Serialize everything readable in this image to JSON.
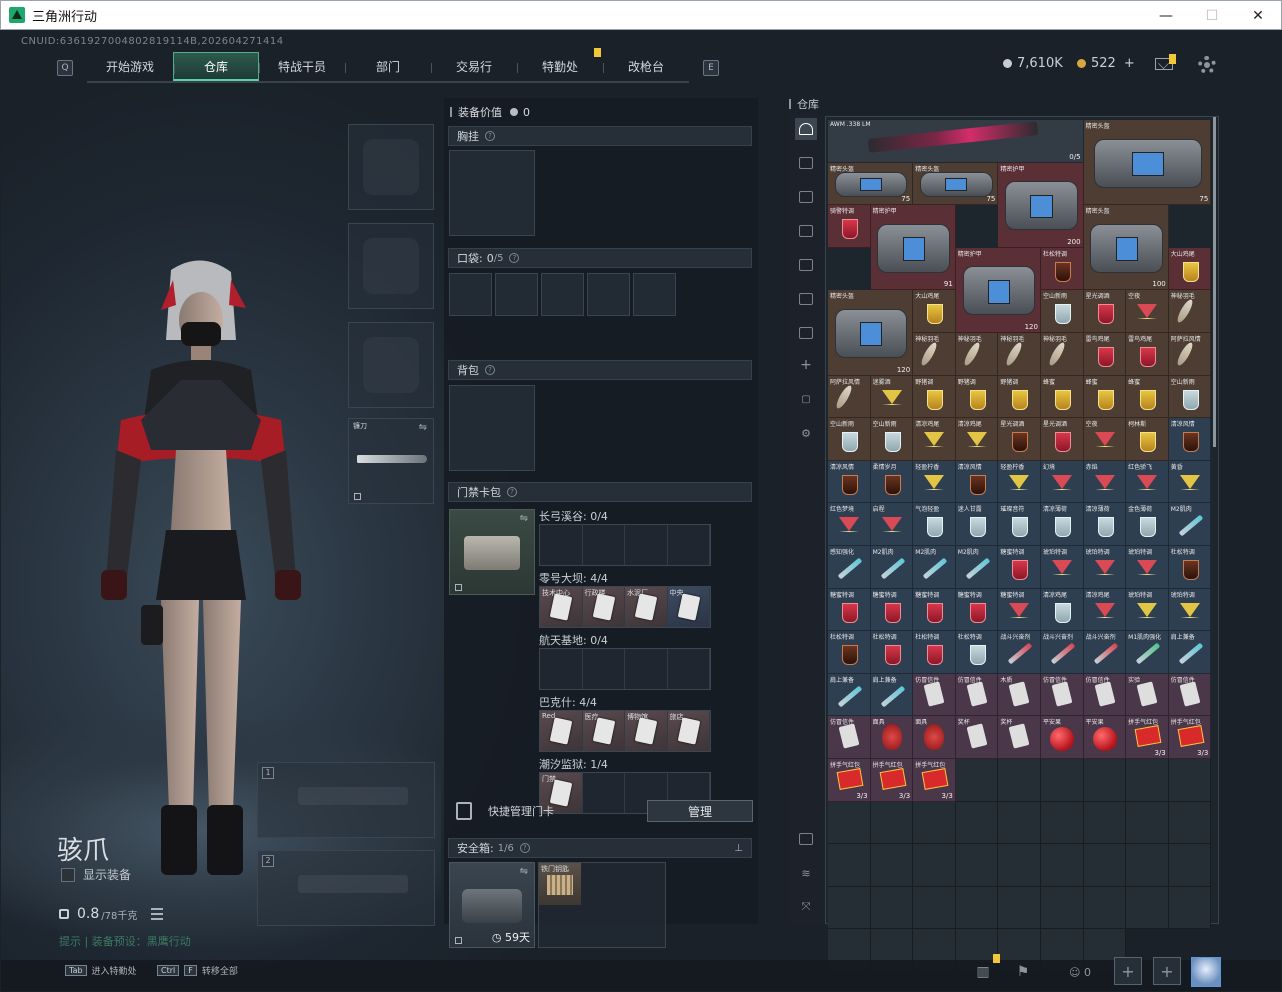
{
  "window": {
    "title": "三角洲行动",
    "controls": [
      "—",
      "☐",
      "✕"
    ]
  },
  "uid_line": "CNUID:6361927004802819114B,202604271414",
  "nav": {
    "left_key": "Q",
    "right_key": "E",
    "tabs": [
      {
        "label": "开始游戏",
        "active": false
      },
      {
        "label": "仓库",
        "active": true
      },
      {
        "label": "特战干员",
        "active": false
      },
      {
        "label": "部门",
        "active": false
      },
      {
        "label": "交易行",
        "active": false
      },
      {
        "label": "特勤处",
        "active": false,
        "badge": true
      },
      {
        "label": "改枪台",
        "active": false
      }
    ]
  },
  "currency": {
    "coins": "7,610K",
    "bonds": "522",
    "bonds_plus": "+"
  },
  "character": {
    "name": "骇爪",
    "show_equipment_label": "显示装备",
    "weight_value": "0.8",
    "weight_max": "/78千克",
    "hint": "提示 | 装备预设：黑鹰行动"
  },
  "gear_slots": {
    "melee_label": "镰刀",
    "gun_slot_1": "1",
    "gun_slot_2": "2"
  },
  "middle": {
    "equipment_value_label": "装备价值",
    "equipment_value": "0",
    "chest_rig": "胸挂",
    "pockets": "口袋:",
    "pockets_count": "0",
    "pockets_total": "/5",
    "backpack": "背包",
    "keycard_pack": "门禁卡包",
    "maps": [
      {
        "label": "长弓溪谷: 0/4",
        "cells": [
          0,
          0,
          0,
          0
        ]
      },
      {
        "label": "零号大坝: 4/4",
        "cells": [
          1,
          1,
          1,
          1
        ],
        "names": [
          "技术中心",
          "行政楼",
          "水泥厂",
          "中央"
        ]
      },
      {
        "label": "航天基地: 0/4",
        "cells": [
          0,
          0,
          0,
          0
        ]
      },
      {
        "label": "巴克什: 4/4",
        "cells": [
          1,
          1,
          1,
          1
        ],
        "names": [
          "Red",
          "医疗",
          "博物馆",
          "旅店"
        ]
      },
      {
        "label": "潮汐监狱: 1/4",
        "cells": [
          1,
          0,
          0,
          0
        ],
        "names": [
          "门禁"
        ]
      }
    ],
    "quick_manage_label": "快捷管理门卡",
    "manage_button": "管理",
    "safe_box_label": "安全箱:",
    "safe_box_count": "1/6",
    "safe_box_timer": "59天",
    "safe_item_name": "铁门钥匙"
  },
  "warehouse": {
    "title": "仓库",
    "items": [
      {
        "name": "AWM .338 LM",
        "kind": "rifle",
        "bg": "bg-gray",
        "span": 6,
        "q": "0/5"
      },
      {
        "name": "精密头盔",
        "kind": "bag",
        "bg": "bg-brown",
        "span": 3,
        "rows": 2,
        "q": "75"
      },
      {
        "name": "精密头盔",
        "kind": "bag",
        "bg": "bg-brown",
        "span": 2,
        "q": "75"
      },
      {
        "name": "精密头盔",
        "kind": "bag",
        "bg": "bg-brown",
        "span": 2,
        "q": "75"
      },
      {
        "name": "精密护甲",
        "kind": "bag",
        "bg": "bg-red",
        "span": 2,
        "rows": 2,
        "q": "200"
      },
      {
        "name": "骑警特调",
        "kind": "glass red",
        "bg": "bg-red"
      },
      {
        "name": "精密护甲",
        "kind": "bag",
        "bg": "bg-red",
        "span": 2,
        "rows": 2,
        "q": "91"
      },
      {
        "name": "精密头盔",
        "kind": "bag",
        "bg": "bg-brown",
        "span": 2,
        "rows": 2,
        "q": "100"
      },
      {
        "name": "精密护甲",
        "kind": "bag",
        "bg": "bg-red",
        "span": 2,
        "rows": 2,
        "q": "120"
      },
      {
        "name": "杜松特调",
        "kind": "glass dark",
        "bg": "bg-red"
      },
      {
        "name": "大山鸡尾",
        "kind": "glass",
        "bg": "bg-red"
      },
      {
        "name": "精密头盔",
        "kind": "bag",
        "bg": "bg-brown",
        "span": 2,
        "rows": 2,
        "q": "120"
      },
      {
        "name": "大山鸡尾",
        "kind": "glass",
        "bg": "bg-brown"
      },
      {
        "name": "空山新雨",
        "kind": "glass clear",
        "bg": "bg-brown"
      },
      {
        "name": "星光调酒",
        "kind": "glass red",
        "bg": "bg-brown"
      },
      {
        "name": "空夜",
        "kind": "glass cone",
        "bg": "bg-brown"
      },
      {
        "name": "神秘羽毛",
        "kind": "feather",
        "bg": "bg-brown"
      },
      {
        "name": "神秘羽毛",
        "kind": "feather",
        "bg": "bg-brown"
      },
      {
        "name": "神秘羽毛",
        "kind": "feather",
        "bg": "bg-brown"
      },
      {
        "name": "神秘羽毛",
        "kind": "feather",
        "bg": "bg-brown"
      },
      {
        "name": "神秘羽毛",
        "kind": "feather",
        "bg": "bg-brown"
      },
      {
        "name": "雷鸟鸡尾",
        "kind": "glass red",
        "bg": "bg-brown"
      },
      {
        "name": "雷鸟鸡尾",
        "kind": "glass red",
        "bg": "bg-brown"
      },
      {
        "name": "阿萨拉风情",
        "kind": "feather",
        "bg": "bg-brown"
      },
      {
        "name": "阿萨拉风情",
        "kind": "feather",
        "bg": "bg-brown"
      },
      {
        "name": "迷雾酒",
        "kind": "glass cone yel",
        "bg": "bg-brown"
      },
      {
        "name": "野猪调",
        "kind": "glass",
        "bg": "bg-brown"
      },
      {
        "name": "野猪调",
        "kind": "glass",
        "bg": "bg-brown"
      },
      {
        "name": "野猪调",
        "kind": "glass",
        "bg": "bg-brown"
      },
      {
        "name": "蜂蜜",
        "kind": "glass",
        "bg": "bg-brown"
      },
      {
        "name": "蜂蜜",
        "kind": "glass",
        "bg": "bg-brown"
      },
      {
        "name": "蜂蜜",
        "kind": "glass",
        "bg": "bg-brown"
      },
      {
        "name": "空山新雨",
        "kind": "glass clear",
        "bg": "bg-brown"
      },
      {
        "name": "空山新雨",
        "kind": "glass clear",
        "bg": "bg-brown"
      },
      {
        "name": "空山新雨",
        "kind": "glass clear",
        "bg": "bg-brown"
      },
      {
        "name": "清凉鸡尾",
        "kind": "glass cone yel",
        "bg": "bg-brown"
      },
      {
        "name": "清凉鸡尾",
        "kind": "glass cone yel",
        "bg": "bg-brown"
      },
      {
        "name": "星光调酒",
        "kind": "glass dark",
        "bg": "bg-brown"
      },
      {
        "name": "星光调酒",
        "kind": "glass red",
        "bg": "bg-brown"
      },
      {
        "name": "空夜",
        "kind": "glass cone",
        "bg": "bg-brown"
      },
      {
        "name": "柯林斯",
        "kind": "glass",
        "bg": "bg-brown"
      },
      {
        "name": "清凉风情",
        "kind": "glass dark",
        "bg": "bg-blue"
      },
      {
        "name": "清凉风情",
        "kind": "glass dark",
        "bg": "bg-blue"
      },
      {
        "name": "柔情岁月",
        "kind": "glass dark",
        "bg": "bg-blue"
      },
      {
        "name": "轻盈柠香",
        "kind": "glass cone yel",
        "bg": "bg-blue"
      },
      {
        "name": "清凉风情",
        "kind": "glass dark",
        "bg": "bg-blue"
      },
      {
        "name": "轻盈柠香",
        "kind": "glass cone yel",
        "bg": "bg-blue"
      },
      {
        "name": "幻境",
        "kind": "glass cone",
        "bg": "bg-blue"
      },
      {
        "name": "赤焰",
        "kind": "glass cone",
        "bg": "bg-blue"
      },
      {
        "name": "红色骄飞",
        "kind": "glass cone",
        "bg": "bg-blue"
      },
      {
        "name": "黄昏",
        "kind": "glass cone yel",
        "bg": "bg-blue"
      },
      {
        "name": "红色梦境",
        "kind": "glass cone",
        "bg": "bg-blue"
      },
      {
        "name": "启程",
        "kind": "glass cone",
        "bg": "bg-blue"
      },
      {
        "name": "气泡轻盈",
        "kind": "glass clear",
        "bg": "bg-blue"
      },
      {
        "name": "迷人甘露",
        "kind": "glass clear",
        "bg": "bg-blue"
      },
      {
        "name": "璀璨音符",
        "kind": "glass clear",
        "bg": "bg-blue"
      },
      {
        "name": "清凉薄荷",
        "kind": "glass clear",
        "bg": "bg-blue"
      },
      {
        "name": "清凉薄荷",
        "kind": "glass clear",
        "bg": "bg-blue"
      },
      {
        "name": "金色薄荷",
        "kind": "glass clear",
        "bg": "bg-blue"
      },
      {
        "name": "M2肌肉",
        "kind": "syr",
        "bg": "bg-blue"
      },
      {
        "name": "感知强化",
        "kind": "syr",
        "bg": "bg-blue"
      },
      {
        "name": "M2肌肉",
        "kind": "syr",
        "bg": "bg-blue"
      },
      {
        "name": "M2肌肉",
        "kind": "syr",
        "bg": "bg-blue"
      },
      {
        "name": "M2肌肉",
        "kind": "syr",
        "bg": "bg-blue"
      },
      {
        "name": "糖蜜特调",
        "kind": "glass red",
        "bg": "bg-blue"
      },
      {
        "name": "琥珀特调",
        "kind": "glass cone",
        "bg": "bg-blue"
      },
      {
        "name": "琥珀特调",
        "kind": "glass cone",
        "bg": "bg-blue"
      },
      {
        "name": "琥珀特调",
        "kind": "glass cone",
        "bg": "bg-blue"
      },
      {
        "name": "杜松特调",
        "kind": "glass dark",
        "bg": "bg-blue"
      },
      {
        "name": "糖蜜特调",
        "kind": "glass red",
        "bg": "bg-blue"
      },
      {
        "name": "糖蜜特调",
        "kind": "glass red",
        "bg": "bg-blue"
      },
      {
        "name": "糖蜜特调",
        "kind": "glass red",
        "bg": "bg-blue"
      },
      {
        "name": "糖蜜特调",
        "kind": "glass red",
        "bg": "bg-blue"
      },
      {
        "name": "糖蜜特调",
        "kind": "glass cone",
        "bg": "bg-blue"
      },
      {
        "name": "清凉鸡尾",
        "kind": "glass clear",
        "bg": "bg-blue"
      },
      {
        "name": "清凉鸡尾",
        "kind": "glass cone",
        "bg": "bg-blue"
      },
      {
        "name": "琥珀特调",
        "kind": "glass cone yel",
        "bg": "bg-blue"
      },
      {
        "name": "琥珀特调",
        "kind": "glass cone yel",
        "bg": "bg-blue"
      },
      {
        "name": "杜松特调",
        "kind": "glass dark",
        "bg": "bg-blue"
      },
      {
        "name": "杜松特调",
        "kind": "glass red",
        "bg": "bg-blue"
      },
      {
        "name": "杜松特调",
        "kind": "glass red",
        "bg": "bg-blue"
      },
      {
        "name": "杜松特调",
        "kind": "glass clear",
        "bg": "bg-blue"
      },
      {
        "name": "战斗兴奋剂",
        "kind": "syr red",
        "bg": "bg-blue"
      },
      {
        "name": "战斗兴奋剂",
        "kind": "syr red",
        "bg": "bg-blue"
      },
      {
        "name": "战斗兴奋剂",
        "kind": "syr red",
        "bg": "bg-blue"
      },
      {
        "name": "M1肌肉强化",
        "kind": "syr grn",
        "bg": "bg-blue"
      },
      {
        "name": "肩上兼备",
        "kind": "syr",
        "bg": "bg-blue"
      },
      {
        "name": "肩上兼备",
        "kind": "syr",
        "bg": "bg-blue"
      },
      {
        "name": "肩上兼备",
        "kind": "syr",
        "bg": "bg-blue"
      },
      {
        "name": "仿冒信件",
        "kind": "paper",
        "bg": "bg-purple"
      },
      {
        "name": "仿冒信件",
        "kind": "paper",
        "bg": "bg-purple"
      },
      {
        "name": "木质",
        "kind": "paper",
        "bg": "bg-purple"
      },
      {
        "name": "仿冒信件",
        "kind": "paper",
        "bg": "bg-purple"
      },
      {
        "name": "仿冒信件",
        "kind": "paper",
        "bg": "bg-purple"
      },
      {
        "name": "实验",
        "kind": "paper",
        "bg": "bg-purple"
      },
      {
        "name": "仿冒信件",
        "kind": "paper",
        "bg": "bg-purple"
      },
      {
        "name": "仿冒信件",
        "kind": "paper",
        "bg": "bg-purple"
      },
      {
        "name": "面具",
        "kind": "mask",
        "bg": "bg-purple"
      },
      {
        "name": "面具",
        "kind": "mask",
        "bg": "bg-purple"
      },
      {
        "name": "奖杯",
        "kind": "paper",
        "bg": "bg-purple"
      },
      {
        "name": "奖杯",
        "kind": "paper",
        "bg": "bg-purple"
      },
      {
        "name": "平安果",
        "kind": "apple",
        "bg": "bg-purple"
      },
      {
        "name": "平安果",
        "kind": "apple",
        "bg": "bg-purple"
      },
      {
        "name": "拼手气红包",
        "kind": "env",
        "bg": "bg-purple",
        "q": "3/3"
      },
      {
        "name": "拼手气红包",
        "kind": "env",
        "bg": "bg-purple",
        "q": "3/3"
      },
      {
        "name": "拼手气红包",
        "kind": "env",
        "bg": "bg-purple",
        "q": "3/3"
      },
      {
        "name": "拼手气红包",
        "kind": "env",
        "bg": "bg-purple",
        "q": "3/3"
      },
      {
        "name": "拼手气红包",
        "kind": "env",
        "bg": "bg-purple",
        "q": "3/3"
      }
    ]
  },
  "footer": {
    "tab_key": "Tab",
    "tab_label": "进入特勤处",
    "ctrl_key": "Ctrl",
    "f_key": "F",
    "transfer_label": "转移全部",
    "friends_count": "0"
  },
  "colors": {
    "accent": "#5bd3a4",
    "badge": "#f3c738"
  }
}
